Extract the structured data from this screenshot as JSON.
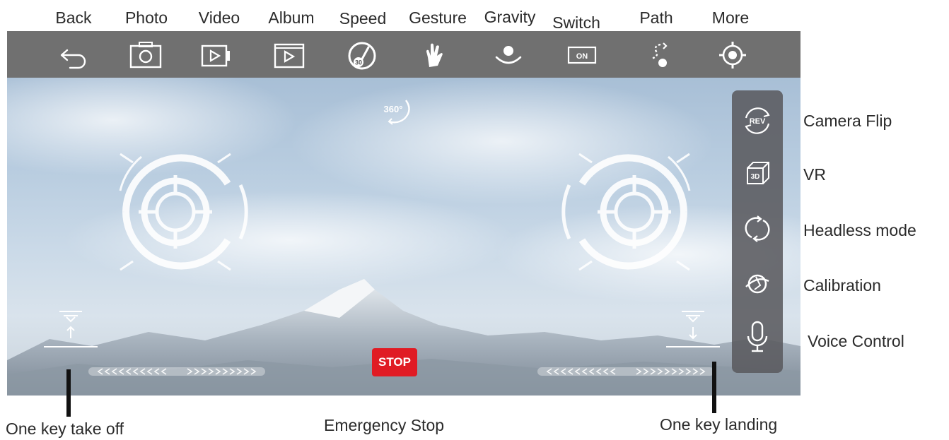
{
  "toolbar": {
    "labels": [
      "Back",
      "Photo",
      "Video",
      "Album",
      "Speed",
      "Gesture",
      "Gravity",
      "Switch",
      "Path",
      "More"
    ],
    "speed_value": "30",
    "switch_value": "ON"
  },
  "screen": {
    "rotate_label": "360°",
    "stop_label": "STOP"
  },
  "right_panel": {
    "labels": [
      "Camera Flip",
      "VR",
      "Headless mode",
      "Calibration",
      "Voice Control"
    ],
    "rev_label": "REV",
    "vr_label": "3D"
  },
  "bottom": {
    "takeoff": "One key take off",
    "emergency": "Emergency Stop",
    "landing": "One key landing"
  },
  "icons": [
    "back-icon",
    "camera-icon",
    "video-icon",
    "album-icon",
    "speed-gauge-icon",
    "hand-gesture-icon",
    "gravity-icon",
    "switch-on-icon",
    "path-icon",
    "gear-icon",
    "rev-icon",
    "cube-3d-icon",
    "headless-icon",
    "calibration-icon",
    "microphone-icon",
    "takeoff-icon",
    "landing-icon"
  ],
  "colors": {
    "toolbar": "#707070",
    "stop": "#e01b24",
    "panel": "#5a5a5f"
  }
}
